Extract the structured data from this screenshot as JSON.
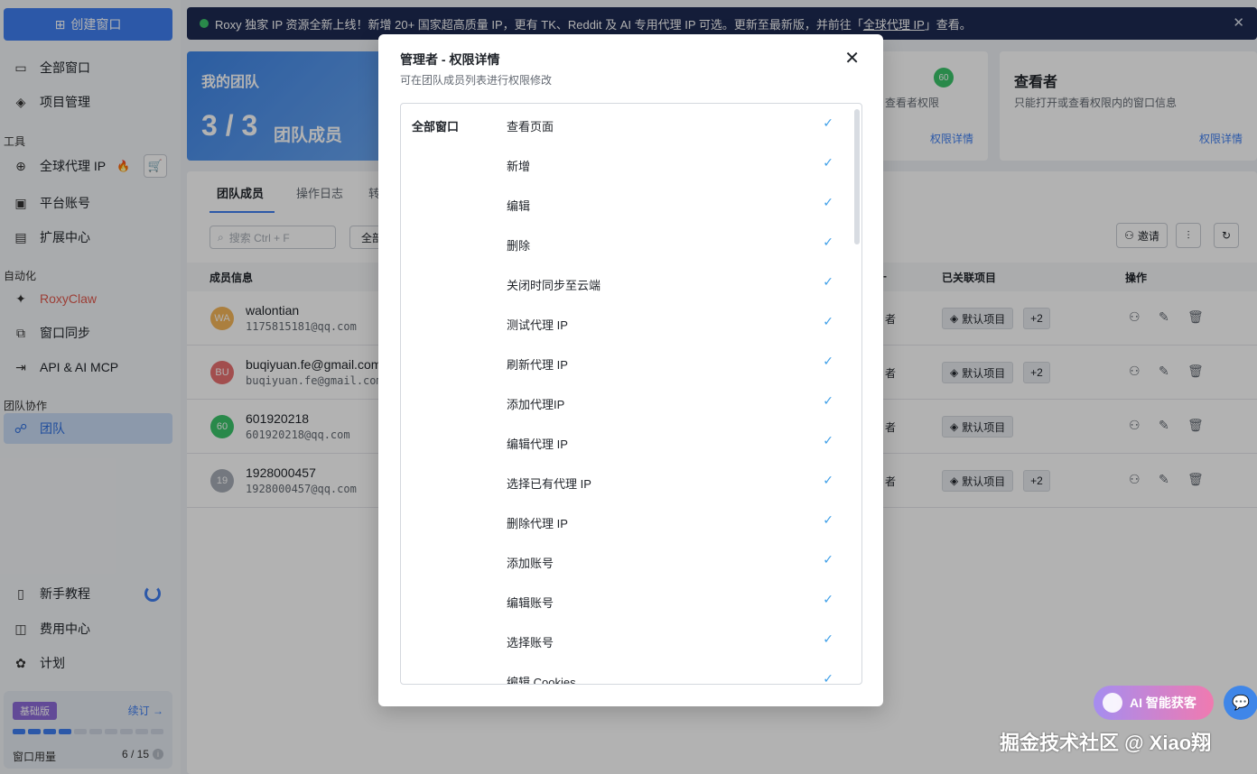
{
  "sidebar": {
    "create_window": "创建窗口",
    "items": [
      {
        "label": "全部窗口",
        "icon": "window-icon"
      },
      {
        "label": "项目管理",
        "icon": "layers-icon"
      }
    ],
    "tools_label": "工具",
    "tools": [
      {
        "label": "全球代理 IP",
        "icon": "globe-icon"
      },
      {
        "label": "平台账号",
        "icon": "account-icon"
      },
      {
        "label": "扩展中心",
        "icon": "extension-icon"
      }
    ],
    "automation_label": "自动化",
    "automation": [
      {
        "label": "RoxyClaw",
        "icon": "claw-icon"
      },
      {
        "label": "窗口同步",
        "icon": "sync-icon"
      },
      {
        "label": "API & AI MCP",
        "icon": "api-icon"
      }
    ],
    "collab_label": "团队协作",
    "team": {
      "label": "团队",
      "icon": "team-icon"
    },
    "bottom": [
      {
        "label": "新手教程",
        "icon": "book-icon"
      },
      {
        "label": "费用中心",
        "icon": "wallet-icon"
      },
      {
        "label": "计划",
        "icon": "gift-icon"
      }
    ],
    "plan": {
      "badge": "基础版",
      "renew": "续订 →",
      "usage_label": "窗口用量",
      "usage_value": "6 / 15",
      "usage_fraction": 0.4
    }
  },
  "banner": {
    "text": "Roxy 独家 IP 资源全新上线！新增 20+ 国家超高质量 IP，更有 TK、Reddit 及 AI 专用代理 IP 可选。更新至最新版，并前往「",
    "link": "全球代理 IP",
    "text_end": "」查看。"
  },
  "team_card": {
    "title": "我的团队",
    "count": "3 / 3",
    "count_label": "团队成员"
  },
  "role_cards": [
    {
      "title": "",
      "desc": "查看者权限",
      "link": "权限详情",
      "badge": "60"
    },
    {
      "title": "查看者",
      "desc": "只能打开或查看权限内的窗口信息",
      "link": "权限详情"
    }
  ],
  "tabs": [
    "团队成员",
    "操作日志",
    "转"
  ],
  "toolbar": {
    "search_placeholder": "搜索 Ctrl + F",
    "filter_label": "全部",
    "invite_label": "邀请"
  },
  "table": {
    "headers": {
      "member": "成员信息",
      "projects": "已关联项目",
      "actions": "操作",
      "role": "-"
    },
    "rows": [
      {
        "avatar": "WA",
        "avatar_color": "#f5b65a",
        "name": "walontian",
        "email": "1175815181@qq.com",
        "role": "者",
        "project": "默认项目",
        "extra": "+2"
      },
      {
        "avatar": "BU",
        "avatar_color": "#e87070",
        "name": "buqiyuan.fe@gmail.com",
        "email": "buqiyuan.fe@gmail.com",
        "role": "者",
        "project": "默认项目",
        "extra": "+2"
      },
      {
        "avatar": "60",
        "avatar_color": "#3cc46a",
        "name": "601920218",
        "email": "601920218@qq.com",
        "role": "者",
        "project": "默认项目",
        "extra": ""
      },
      {
        "avatar": "19",
        "avatar_color": "#a7adb6",
        "name": "1928000457",
        "email": "1928000457@qq.com",
        "role": "者",
        "project": "默认项目",
        "extra": "+2"
      }
    ]
  },
  "modal": {
    "title": "管理者 - 权限详情",
    "subtitle": "可在团队成员列表进行权限修改",
    "group": "全部窗口",
    "permissions": [
      "查看页面",
      "新增",
      "编辑",
      "删除",
      "关闭时同步至云端",
      "测试代理 IP",
      "刷新代理 IP",
      "添加代理IP",
      "编辑代理 IP",
      "选择已有代理 IP",
      "删除代理 IP",
      "添加账号",
      "编辑账号",
      "选择账号",
      "编辑 Cookies"
    ]
  },
  "widgets": {
    "ai_label": "AI 智能获客",
    "watermark": "掘金技术社区 @ Xiao翔"
  },
  "colors": {
    "accent": "#3f7ff1",
    "banner_bg": "#1e2a52",
    "check": "#3f9fe8"
  }
}
